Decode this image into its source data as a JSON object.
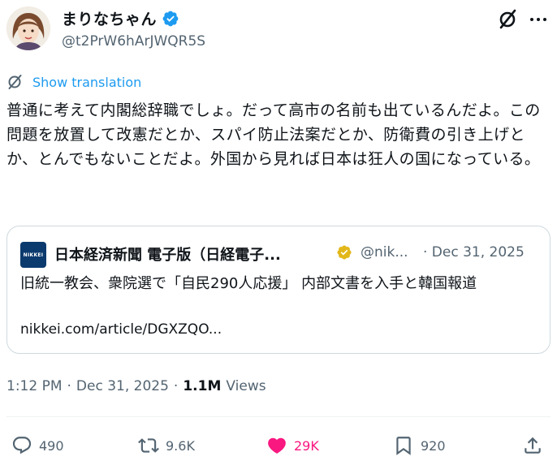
{
  "author": {
    "display_name": "まりなちゃん",
    "handle": "@t2PrW6hArJWQR5S"
  },
  "translate_label": "Show translation",
  "tweet_text": "普通に考えて内閣総辞職でしょ。だって高市の名前も出ているんだよ。この問題を放置して改憲だとか、スパイ防止法案だとか、防衛費の引き上げとか、とんでもないことだよ。外国から見れば日本は狂人の国になっている。",
  "quote": {
    "logo_text": "NIKKEI",
    "name": "日本経済新聞 電子版（日経電子...",
    "handle": "@nik...",
    "date": "· Dec 31, 2025",
    "body": "旧統一教会、衆院選で「自民290人応援」 内部文書を入手と韓国報道",
    "link": "nikkei.com/article/DGXZQO..."
  },
  "meta": {
    "time": "1:12 PM",
    "sep1": "·",
    "date": "Dec 31, 2025",
    "sep2": "·",
    "views_count": "1.1M",
    "views_label": "Views"
  },
  "actions": {
    "replies": "490",
    "reposts": "9.6K",
    "likes": "29K",
    "bookmarks": "920"
  },
  "colors": {
    "accent": "#1d9bf0",
    "like": "#f91880",
    "muted": "#536471",
    "gold_badge": "#e2b719"
  }
}
